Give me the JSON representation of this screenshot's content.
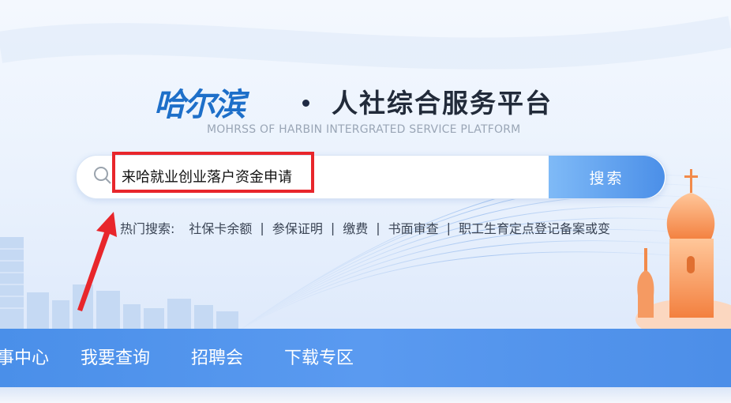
{
  "header": {
    "logo_text": "哈尔滨",
    "title": "人社综合服务平台",
    "subtitle": "MOHRSS OF HARBIN INTERGRATED SERVICE PLATFORM"
  },
  "search": {
    "icon": "search-icon",
    "value": "来哈就业创业落户资金申请",
    "button_label": "搜索"
  },
  "hot_search": {
    "label": "热门搜索:",
    "items": [
      "社保卡余额",
      "参保证明",
      "缴费",
      "书面审查",
      "职工生育定点登记备案或变"
    ],
    "separator": "|"
  },
  "nav": {
    "items": [
      "事中心",
      "我要查询",
      "招聘会",
      "下载专区"
    ]
  },
  "colors": {
    "brand_blue": "#4a8fe9",
    "highlight_red": "#e8262b",
    "title_dark": "#222b3a"
  }
}
